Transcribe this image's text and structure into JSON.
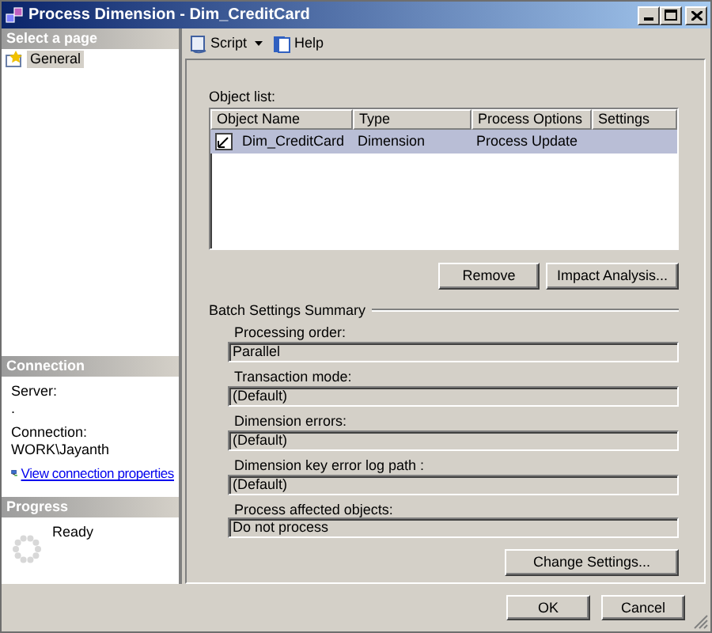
{
  "window": {
    "title": "Process Dimension - Dim_CreditCard"
  },
  "sidebar": {
    "header": "Select a page",
    "pages": [
      {
        "label": "General",
        "selected": true
      }
    ],
    "connection": {
      "header": "Connection",
      "server_label": "Server:",
      "server_value": ".",
      "connection_label": "Connection:",
      "connection_value": "WORK\\Jayanth",
      "link": "View connection properties"
    },
    "progress": {
      "header": "Progress",
      "status": "Ready"
    }
  },
  "toolbar": [
    {
      "label": "Script",
      "kind": "dropdown"
    },
    {
      "label": "Help",
      "kind": "button"
    }
  ],
  "object_list": {
    "label": "Object list:",
    "columns": [
      "Object Name",
      "Type",
      "Process Options",
      "Settings"
    ],
    "rows": [
      {
        "cells": [
          "Dim_CreditCard",
          "Dimension",
          "Process Update",
          ""
        ],
        "selected": true
      }
    ],
    "buttons": [
      "Remove",
      "Impact Analysis..."
    ]
  },
  "batch_settings": {
    "title": "Batch Settings Summary",
    "fields": [
      {
        "label": "Processing order:",
        "value": "Parallel"
      },
      {
        "label": "Transaction mode:",
        "value": "(Default)"
      },
      {
        "label": "Dimension errors:",
        "value": "(Default)"
      },
      {
        "label": "Dimension key error log path :",
        "value": "(Default)"
      },
      {
        "label": "Process affected objects:",
        "value": "Do not process"
      }
    ],
    "button": "Change Settings..."
  },
  "footer_buttons": [
    "OK",
    "Cancel"
  ]
}
